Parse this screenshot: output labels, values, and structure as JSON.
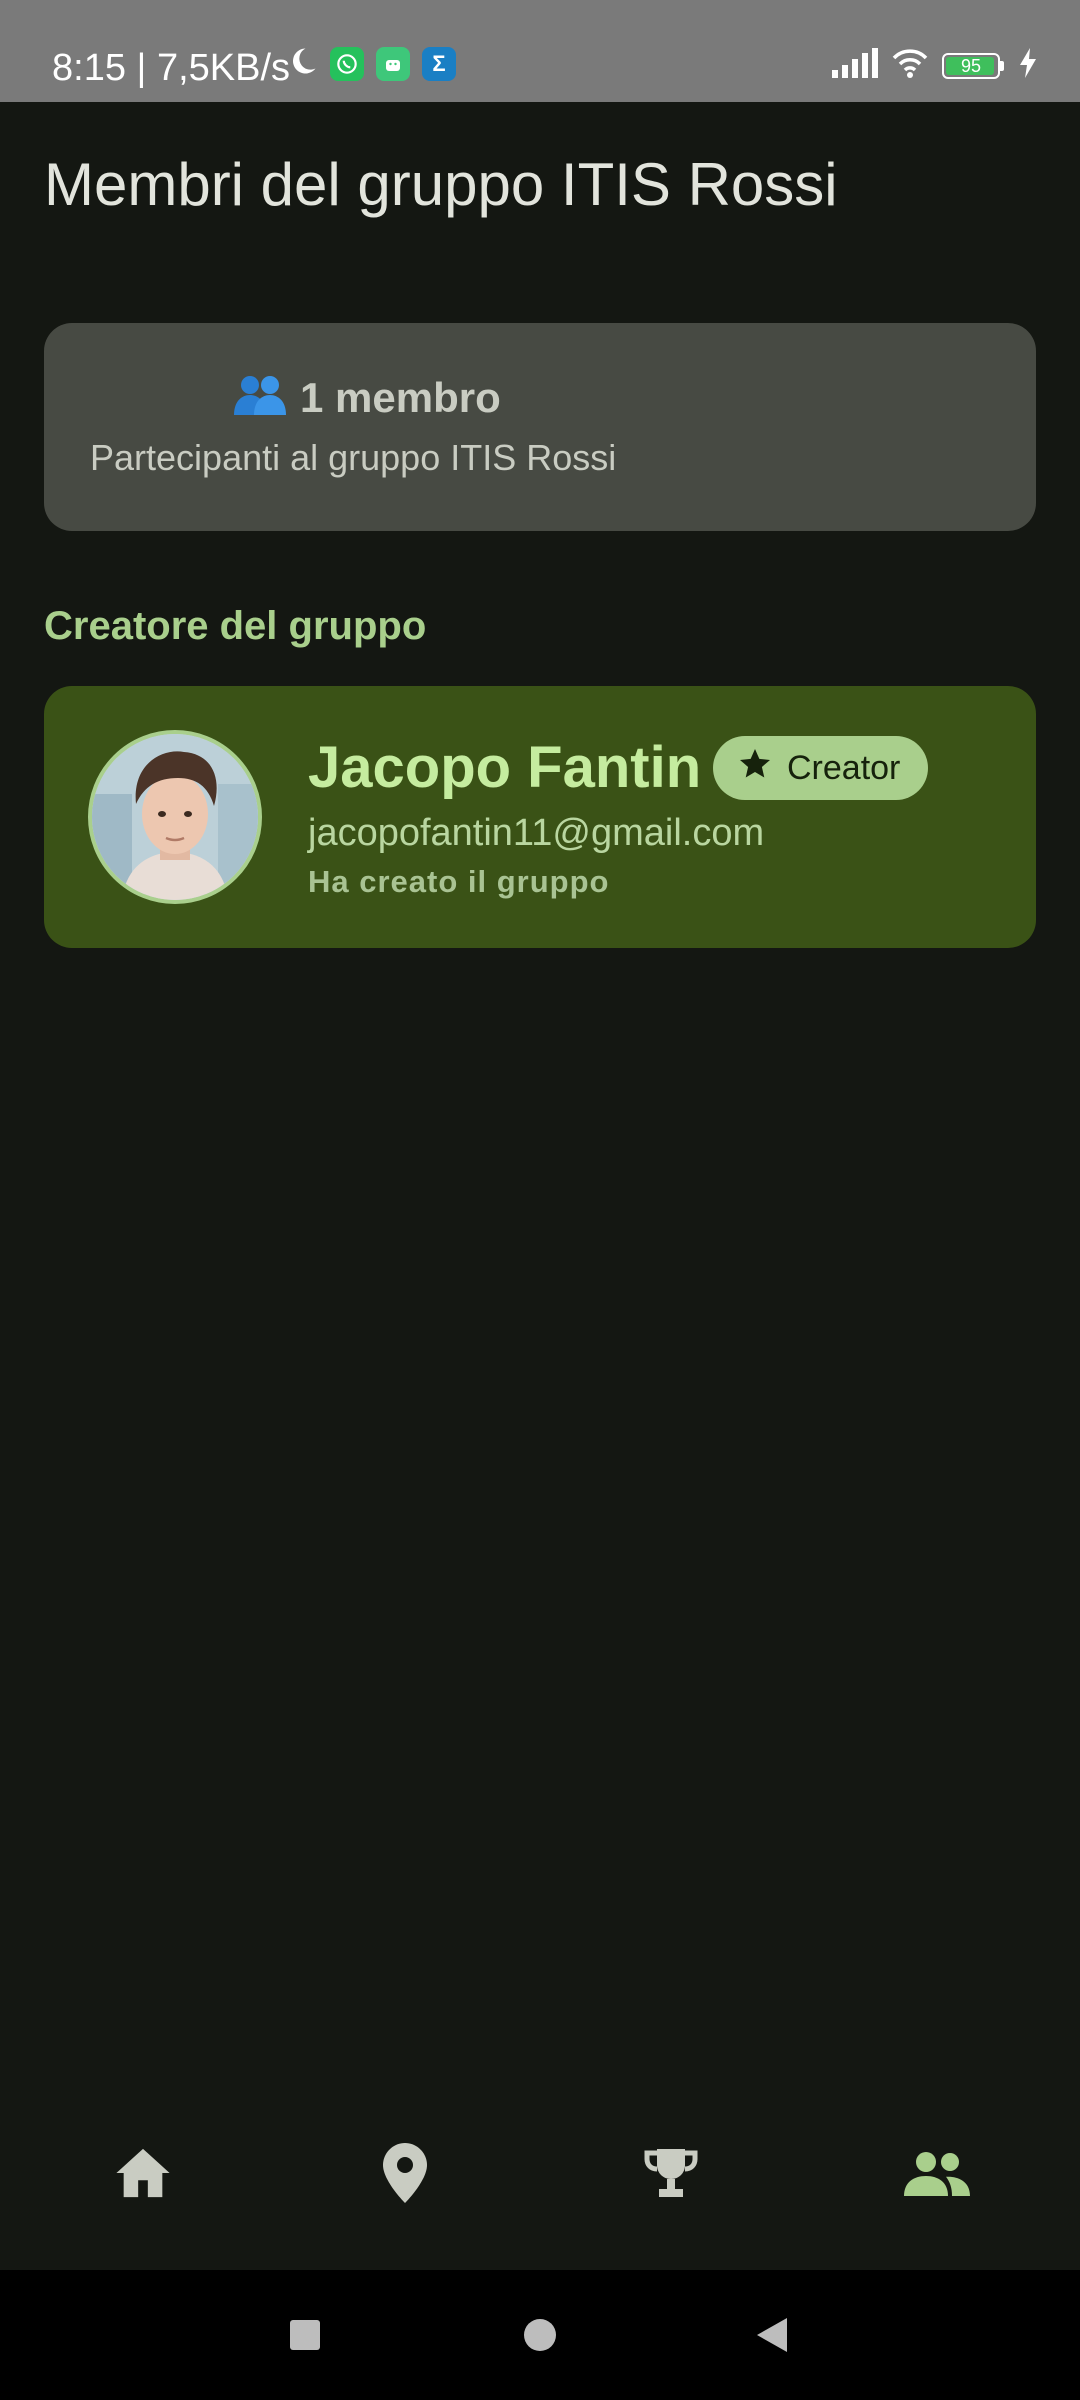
{
  "status_bar": {
    "time_text": "8:15 | 7,5KB/s",
    "battery_level": "95",
    "battery_percent": 95,
    "icons": [
      "moon-icon",
      "whatsapp-icon",
      "android-app-icon",
      "sigma-app-icon",
      "signal-icon",
      "wifi-icon",
      "battery-icon",
      "charging-icon"
    ]
  },
  "page": {
    "title": "Membri del gruppo ITIS Rossi"
  },
  "members_card": {
    "icon": "people-emoji",
    "count": "1 membro",
    "subtitle": "Partecipanti al gruppo ITIS Rossi"
  },
  "creator_section": {
    "title": "Creatore del gruppo",
    "name": "Jacopo Fantin",
    "badge_label": "Creator",
    "email": "jacopofantin11@gmail.com",
    "note": "Ha creato il gruppo"
  },
  "bottom_nav": {
    "items": [
      {
        "name": "home",
        "icon": "home-icon",
        "active": false
      },
      {
        "name": "map",
        "icon": "location-pin-icon",
        "active": false
      },
      {
        "name": "leaderboard",
        "icon": "trophy-icon",
        "active": false
      },
      {
        "name": "group",
        "icon": "group-icon",
        "active": true
      }
    ]
  },
  "colors": {
    "background": "#141712",
    "accent": "#a9cf8c",
    "creator_card": "#3a5216",
    "members_card": "#474a43",
    "nav_inactive": "#c9ccc2"
  }
}
